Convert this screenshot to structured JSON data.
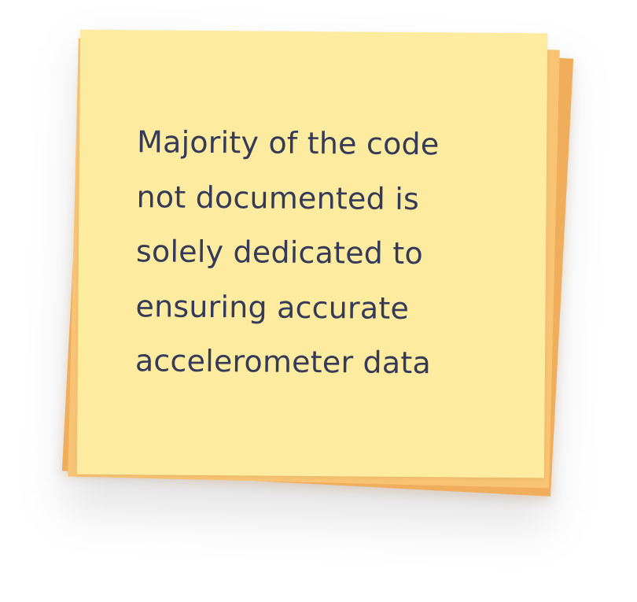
{
  "note": {
    "lines": [
      "Majority of the code",
      "not documented is",
      "solely dedicated to",
      "ensuring accurate",
      "accelerometer data"
    ]
  },
  "colors": {
    "front_note": "#fdeca0",
    "middle_note": "#f8c474",
    "back_note": "#f0ad5c",
    "text": "#343a57"
  }
}
